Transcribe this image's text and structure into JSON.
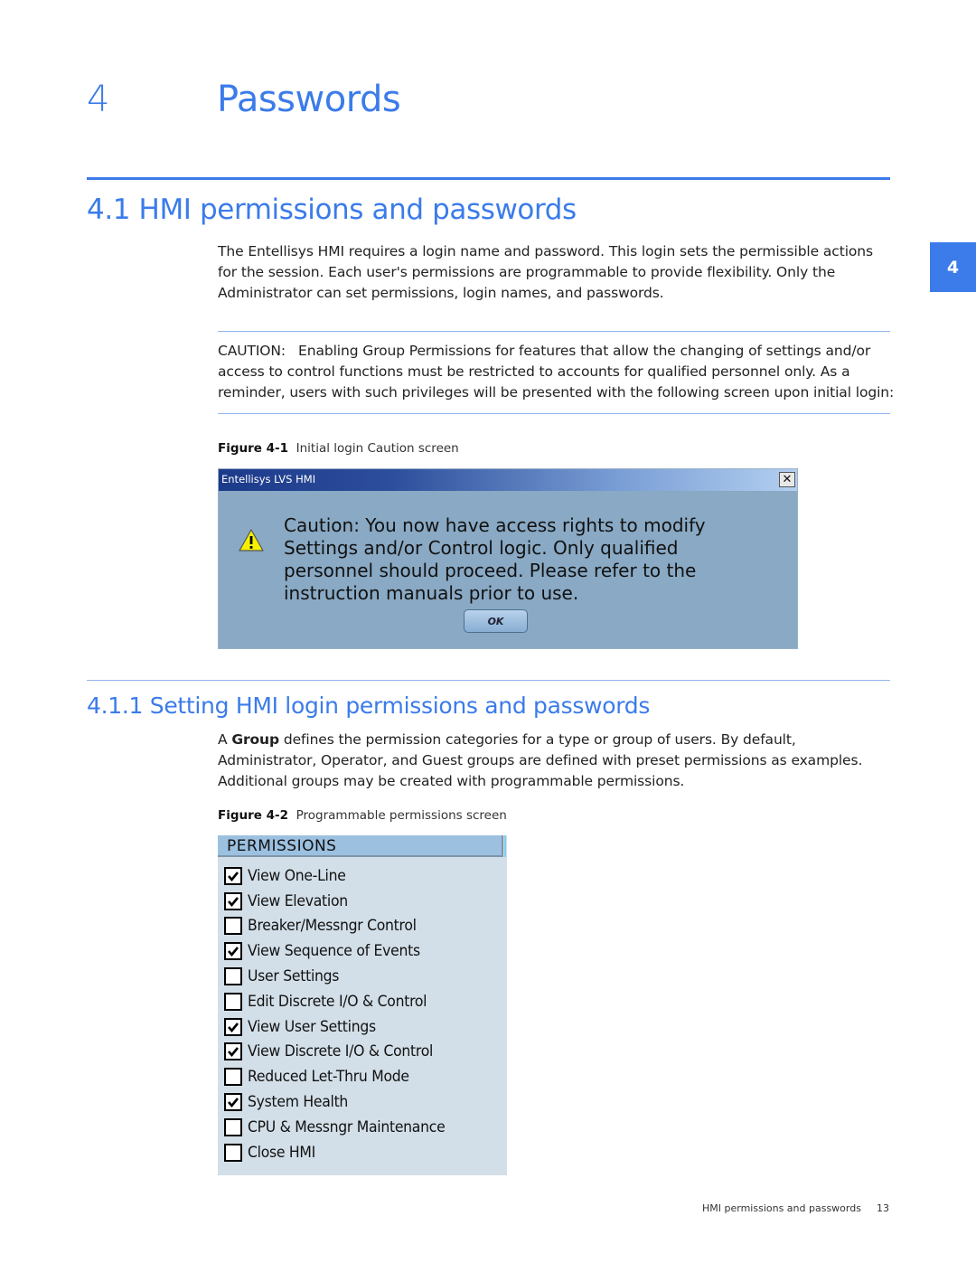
{
  "chapter": {
    "number": "4",
    "title": "Passwords"
  },
  "section": {
    "title": "4.1 HMI permissions and passwords"
  },
  "side_tab": "4",
  "intro_paragraph": "The Entellisys HMI requires a login name and password. This login sets the permissible actions for the session. Each user's permissions are programmable to provide flexibility. Only the Administrator can set permissions, login names, and passwords.",
  "caution": {
    "label": "CAUTION:",
    "text": "Enabling Group Permissions for features that allow the changing of settings and/or access to control functions must be restricted to accounts for qualified personnel only. As a reminder, users with such privileges will be presented with the following screen upon initial login:"
  },
  "figure1": {
    "label": "Figure 4-1",
    "caption": "Initial login Caution screen",
    "dialog": {
      "title": "Entellisys LVS HMI",
      "close_icon": "close-x-icon",
      "warning_icon": "warning-triangle-icon",
      "message": "Caution: You now have access rights to modify Settings and/or Control logic. Only qualified personnel should proceed. Please refer to the instruction manuals prior to use.",
      "ok_label": "OK"
    }
  },
  "subsection": {
    "title": "4.1.1 Setting HMI login permissions and passwords"
  },
  "group_paragraph": {
    "prefix": "A ",
    "bold": "Group",
    "rest": " defines the permission categories for a type or group of users. By default, Administrator, Operator, and Guest groups are defined with preset permissions as examples. Additional groups may be created with programmable permissions."
  },
  "figure2": {
    "label": "Figure 4-2",
    "caption": "Programmable permissions screen",
    "panel_title": "PERMISSIONS",
    "permissions": [
      {
        "label": "View One-Line",
        "checked": true
      },
      {
        "label": "View Elevation",
        "checked": true
      },
      {
        "label": "Breaker/Messngr Control",
        "checked": false
      },
      {
        "label": "View Sequence of Events",
        "checked": true
      },
      {
        "label": "User Settings",
        "checked": false
      },
      {
        "label": "Edit Discrete I/O & Control",
        "checked": false
      },
      {
        "label": "View User Settings",
        "checked": true
      },
      {
        "label": "View Discrete I/O & Control",
        "checked": true
      },
      {
        "label": "Reduced Let-Thru Mode",
        "checked": false
      },
      {
        "label": "System Health",
        "checked": true
      },
      {
        "label": "CPU & Messngr Maintenance",
        "checked": false
      },
      {
        "label": "Close HMI",
        "checked": false
      }
    ]
  },
  "footer": {
    "title": "HMI permissions and passwords",
    "page": "13"
  },
  "colors": {
    "accent": "#3b7bea",
    "rule_light": "#93b4ee",
    "dialog_bg": "#89a9c4",
    "panel_bg": "#d3dfe8"
  }
}
